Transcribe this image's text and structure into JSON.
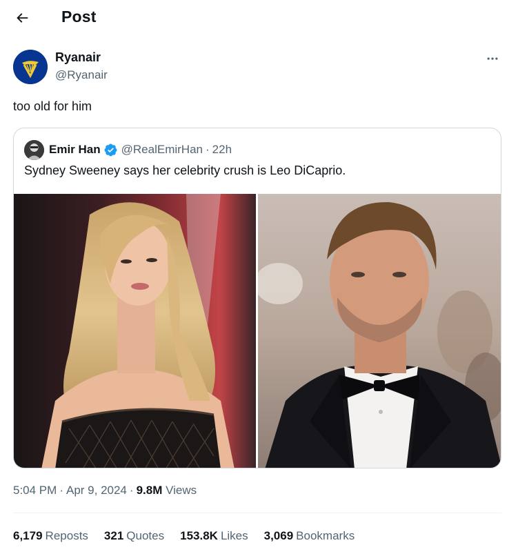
{
  "header": {
    "title": "Post",
    "back_icon": "arrow-left-icon"
  },
  "post": {
    "author": {
      "name": "Ryanair",
      "handle": "@Ryanair",
      "avatar_color": "#073590",
      "logo_color": "#f1c933"
    },
    "text": "too old for him",
    "more_icon": "more-horizontal-icon",
    "quoted": {
      "author": {
        "name": "Emir Han",
        "handle": "@RealEmirHan",
        "verified": true,
        "verified_color": "#1d9bf0"
      },
      "separator": "·",
      "time": "22h",
      "text": "Sydney Sweeney says her celebrity crush is Leo DiCaprio.",
      "images": [
        "photo-woman-red-carpet",
        "photo-man-tuxedo"
      ]
    },
    "meta": {
      "time": "5:04 PM",
      "date": "Apr 9, 2024",
      "views_count": "9.8M",
      "views_label": "Views",
      "dot": "·"
    },
    "stats": {
      "reposts": {
        "count": "6,179",
        "label": "Reposts"
      },
      "quotes": {
        "count": "321",
        "label": "Quotes"
      },
      "likes": {
        "count": "153.8K",
        "label": "Likes"
      },
      "bookmarks": {
        "count": "3,069",
        "label": "Bookmarks"
      }
    }
  }
}
